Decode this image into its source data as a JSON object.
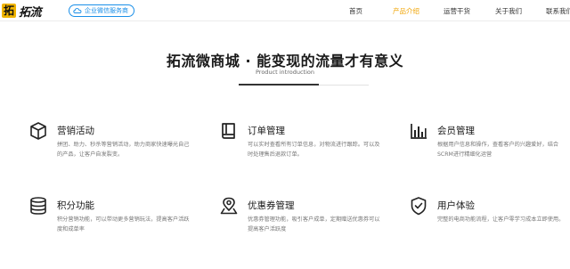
{
  "brand": {
    "logo_mark": "拓",
    "name": "拓流",
    "badge": "企业微信服务商"
  },
  "nav": {
    "items": [
      {
        "label": "首页",
        "active": false
      },
      {
        "label": "产品介绍",
        "active": true
      },
      {
        "label": "运营干货",
        "active": false
      },
      {
        "label": "关于我们",
        "active": false
      },
      {
        "label": "联系我们",
        "active": false
      }
    ]
  },
  "section": {
    "title": "拓流微商城 · 能变现的流量才有意义",
    "subtitle": "Product introduction"
  },
  "features": [
    {
      "icon": "box-icon",
      "title": "营销活动",
      "desc": "拼团、助力、秒杀等营销活动，助力商家快速曝光自己的产品，让客户自发裂变。"
    },
    {
      "icon": "book-icon",
      "title": "订单管理",
      "desc": "可以实时查看所有订单信息，对物流进行跟踪。可以及时处理售后退款订单。"
    },
    {
      "icon": "bar-chart-icon",
      "title": "会员管理",
      "desc": "根据用户信息和操作，查看客户的兴趣爱好，结合SCRM进行精细化运营"
    },
    {
      "icon": "database-icon",
      "title": "积分功能",
      "desc": "积分营销功能，可以带动更多营销玩法，提高客户活跃度和成单率"
    },
    {
      "icon": "map-pin-icon",
      "title": "优惠券管理",
      "desc": "优惠券管理功能，吸引客户成单，定期赠送优惠券可以提高客户活跃度"
    },
    {
      "icon": "shield-check-icon",
      "title": "用户体验",
      "desc": "完整的电商功能流程，让客户零学习成本立即使用。"
    }
  ],
  "colors": {
    "accent": "#f0a300",
    "brand": "#f0b400",
    "badge": "#1b8fe8"
  }
}
